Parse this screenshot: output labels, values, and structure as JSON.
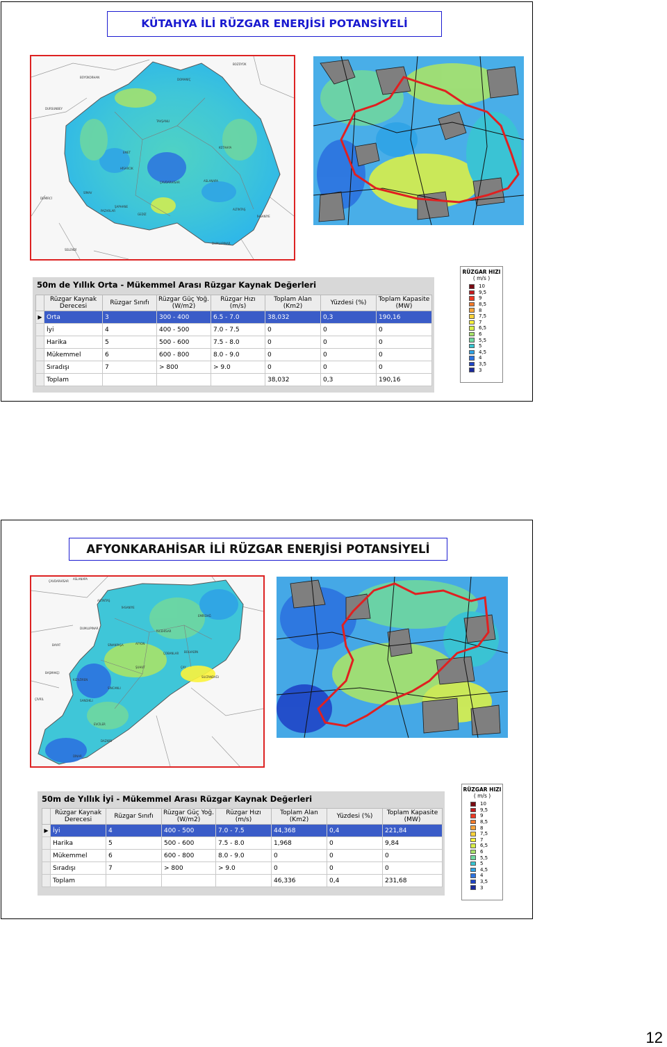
{
  "slides": [
    {
      "title": "KÜTAHYA İLİ RÜZGAR ENERJİSİ POTANSİYELİ",
      "table_title": "50m de Yıllık Orta - Mükemmel Arası Rüzgar Kaynak Değerleri",
      "headers": [
        "Rüzgar Kaynak Derecesi",
        "Rüzgar Sınıfı",
        "Rüzgar Güç Yoğ. (W/m2)",
        "Rüzgar Hızı (m/s)",
        "Toplam Alan (Km2)",
        "Yüzdesi (%)",
        "Toplam Kapasite (MW)"
      ],
      "rows": [
        {
          "cells": [
            "Orta",
            "3",
            "300 - 400",
            "6.5 - 7.0",
            "38,032",
            "0,3",
            "190,16"
          ],
          "selected": true
        },
        {
          "cells": [
            "İyi",
            "4",
            "400 - 500",
            "7.0 - 7.5",
            "0",
            "0",
            "0"
          ]
        },
        {
          "cells": [
            "Harika",
            "5",
            "500 - 600",
            "7.5 - 8.0",
            "0",
            "0",
            "0"
          ]
        },
        {
          "cells": [
            "Mükemmel",
            "6",
            "600 - 800",
            "8.0 - 9.0",
            "0",
            "0",
            "0"
          ]
        },
        {
          "cells": [
            "Sıradışı",
            "7",
            "> 800",
            "> 9.0",
            "0",
            "0",
            "0"
          ]
        },
        {
          "cells": [
            "Toplam",
            "",
            "",
            "",
            "38,032",
            "0,3",
            "190,16"
          ]
        }
      ]
    },
    {
      "title": "AFYONKARAHİSAR İLİ RÜZGAR ENERJİSİ POTANSİYELİ",
      "table_title": "50m de Yıllık İyi - Mükemmel Arası Rüzgar Kaynak Değerleri",
      "headers": [
        "Rüzgar Kaynak Derecesi",
        "Rüzgar Sınıfı",
        "Rüzgar Güç Yoğ. (W/m2)",
        "Rüzgar Hızı (m/s)",
        "Toplam Alan (Km2)",
        "Yüzdesi (%)",
        "Toplam Kapasite (MW)"
      ],
      "rows": [
        {
          "cells": [
            "İyi",
            "4",
            "400 - 500",
            "7.0 - 7.5",
            "44,368",
            "0,4",
            "221,84"
          ],
          "selected": true
        },
        {
          "cells": [
            "Harika",
            "5",
            "500 - 600",
            "7.5 - 8.0",
            "1,968",
            "0",
            "9,84"
          ]
        },
        {
          "cells": [
            "Mükemmel",
            "6",
            "600 - 800",
            "8.0 - 9.0",
            "0",
            "0",
            "0"
          ]
        },
        {
          "cells": [
            "Sıradışı",
            "7",
            "> 800",
            "> 9.0",
            "0",
            "0",
            "0"
          ]
        },
        {
          "cells": [
            "Toplam",
            "",
            "",
            "",
            "46,336",
            "0,4",
            "231,68"
          ]
        }
      ]
    }
  ],
  "legend": {
    "title": "RÜZGAR HIZI",
    "unit": "( m/s )",
    "items": [
      {
        "value": "10",
        "color": "#7a0a12"
      },
      {
        "value": "9,5",
        "color": "#c51a1f"
      },
      {
        "value": "9",
        "color": "#ee3a24"
      },
      {
        "value": "8,5",
        "color": "#f37a2a"
      },
      {
        "value": "8",
        "color": "#f7a43a"
      },
      {
        "value": "7,5",
        "color": "#f9d23b"
      },
      {
        "value": "7",
        "color": "#fcf43c"
      },
      {
        "value": "6,5",
        "color": "#d9ef4a"
      },
      {
        "value": "6",
        "color": "#a8e36a"
      },
      {
        "value": "5,5",
        "color": "#6fd7a0"
      },
      {
        "value": "5",
        "color": "#39c6d2"
      },
      {
        "value": "4,5",
        "color": "#2fa3e6"
      },
      {
        "value": "4",
        "color": "#2c73e0"
      },
      {
        "value": "3,5",
        "color": "#1f45c7"
      },
      {
        "value": "3",
        "color": "#1a2a9c"
      }
    ]
  },
  "maps": {
    "kutahya": {
      "place_labels": [
        "BOZÜYÜK",
        "BÜYÜKORHAN",
        "DURSUNBEY",
        "EMET",
        "TAVŞANLI",
        "KÜTAHYA",
        "HİSARCIK",
        "ÇAVDARHİSAR",
        "ASLANAPA",
        "ŞAPHANE",
        "GEDİZ",
        "SİMAV",
        "DUMLUPINAR",
        "ALTINTAŞ",
        "İHSANİYE",
        "SELENDİ",
        "DEMİRCİ",
        "PAZARLAR",
        "DOMANİÇ"
      ]
    },
    "afyon": {
      "place_labels": [
        "ÇAVDARHİSAR",
        "ASLANAPA",
        "ALTINTAŞ",
        "İHSANİYE",
        "DUMLUPINAR",
        "EMİRDAĞ",
        "İSCEHİSAR",
        "SİNANPAŞA",
        "AFYON",
        "ŞUHUT",
        "ÇAY",
        "BOLVADİN",
        "SULTANDAĞI",
        "DİNAR",
        "DAZKIRI",
        "EVCİLER",
        "SANDIKLI",
        "KIZILÖREN",
        "BAŞMAKÇI",
        "ÇİVRİL",
        "SİNCANLI",
        "BAYAT",
        "ÇOBANLAR"
      ]
    }
  },
  "page_number": "12"
}
